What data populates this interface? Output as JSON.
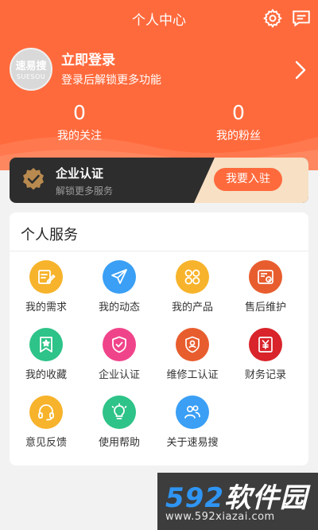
{
  "nav": {
    "title": "个人中心",
    "settings_icon": "gear-icon",
    "message_icon": "message-icon"
  },
  "profile": {
    "avatar_text": "速易搜",
    "avatar_sub": "SUESOU",
    "login_title": "立即登录",
    "login_subtitle": "登录后解锁更多功能",
    "chevron_icon": "chevron-right-icon"
  },
  "stats": [
    {
      "value": "0",
      "label": "我的关注"
    },
    {
      "value": "0",
      "label": "我的粉丝"
    }
  ],
  "cert_banner": {
    "title": "企业认证",
    "subtitle": "解锁更多服务",
    "button": "我要入驻",
    "icon": "verified-badge-icon"
  },
  "services": {
    "title": "个人服务",
    "items": [
      {
        "label": "我的需求",
        "icon": "edit-note-icon",
        "color": "#f7b32b"
      },
      {
        "label": "我的动态",
        "icon": "send-icon",
        "color": "#3a9ff5"
      },
      {
        "label": "我的产品",
        "icon": "clover-icon",
        "color": "#f7b32b"
      },
      {
        "label": "售后维护",
        "icon": "wrench-card-icon",
        "color": "#e85d2e"
      },
      {
        "label": "我的收藏",
        "icon": "bookmark-star-icon",
        "color": "#2ec388"
      },
      {
        "label": "企业认证",
        "icon": "shield-check-icon",
        "color": "#f0448a"
      },
      {
        "label": "维修工认证",
        "icon": "worker-badge-icon",
        "color": "#e85d2e"
      },
      {
        "label": "财务记录",
        "icon": "yen-receipt-icon",
        "color": "#d8242a"
      },
      {
        "label": "意见反馈",
        "icon": "headset-icon",
        "color": "#f7b32b"
      },
      {
        "label": "使用帮助",
        "icon": "lightbulb-icon",
        "color": "#2ec388"
      },
      {
        "label": "关于速易搜",
        "icon": "people-icon",
        "color": "#3a9ff5"
      }
    ]
  },
  "watermark": {
    "logo_num": "592",
    "logo_text": "软件园",
    "url": "www.592xiazai.com"
  },
  "colors": {
    "brand": "#ff6a3c",
    "background": "#f2f2f2",
    "banner": "#2d2d2d"
  }
}
